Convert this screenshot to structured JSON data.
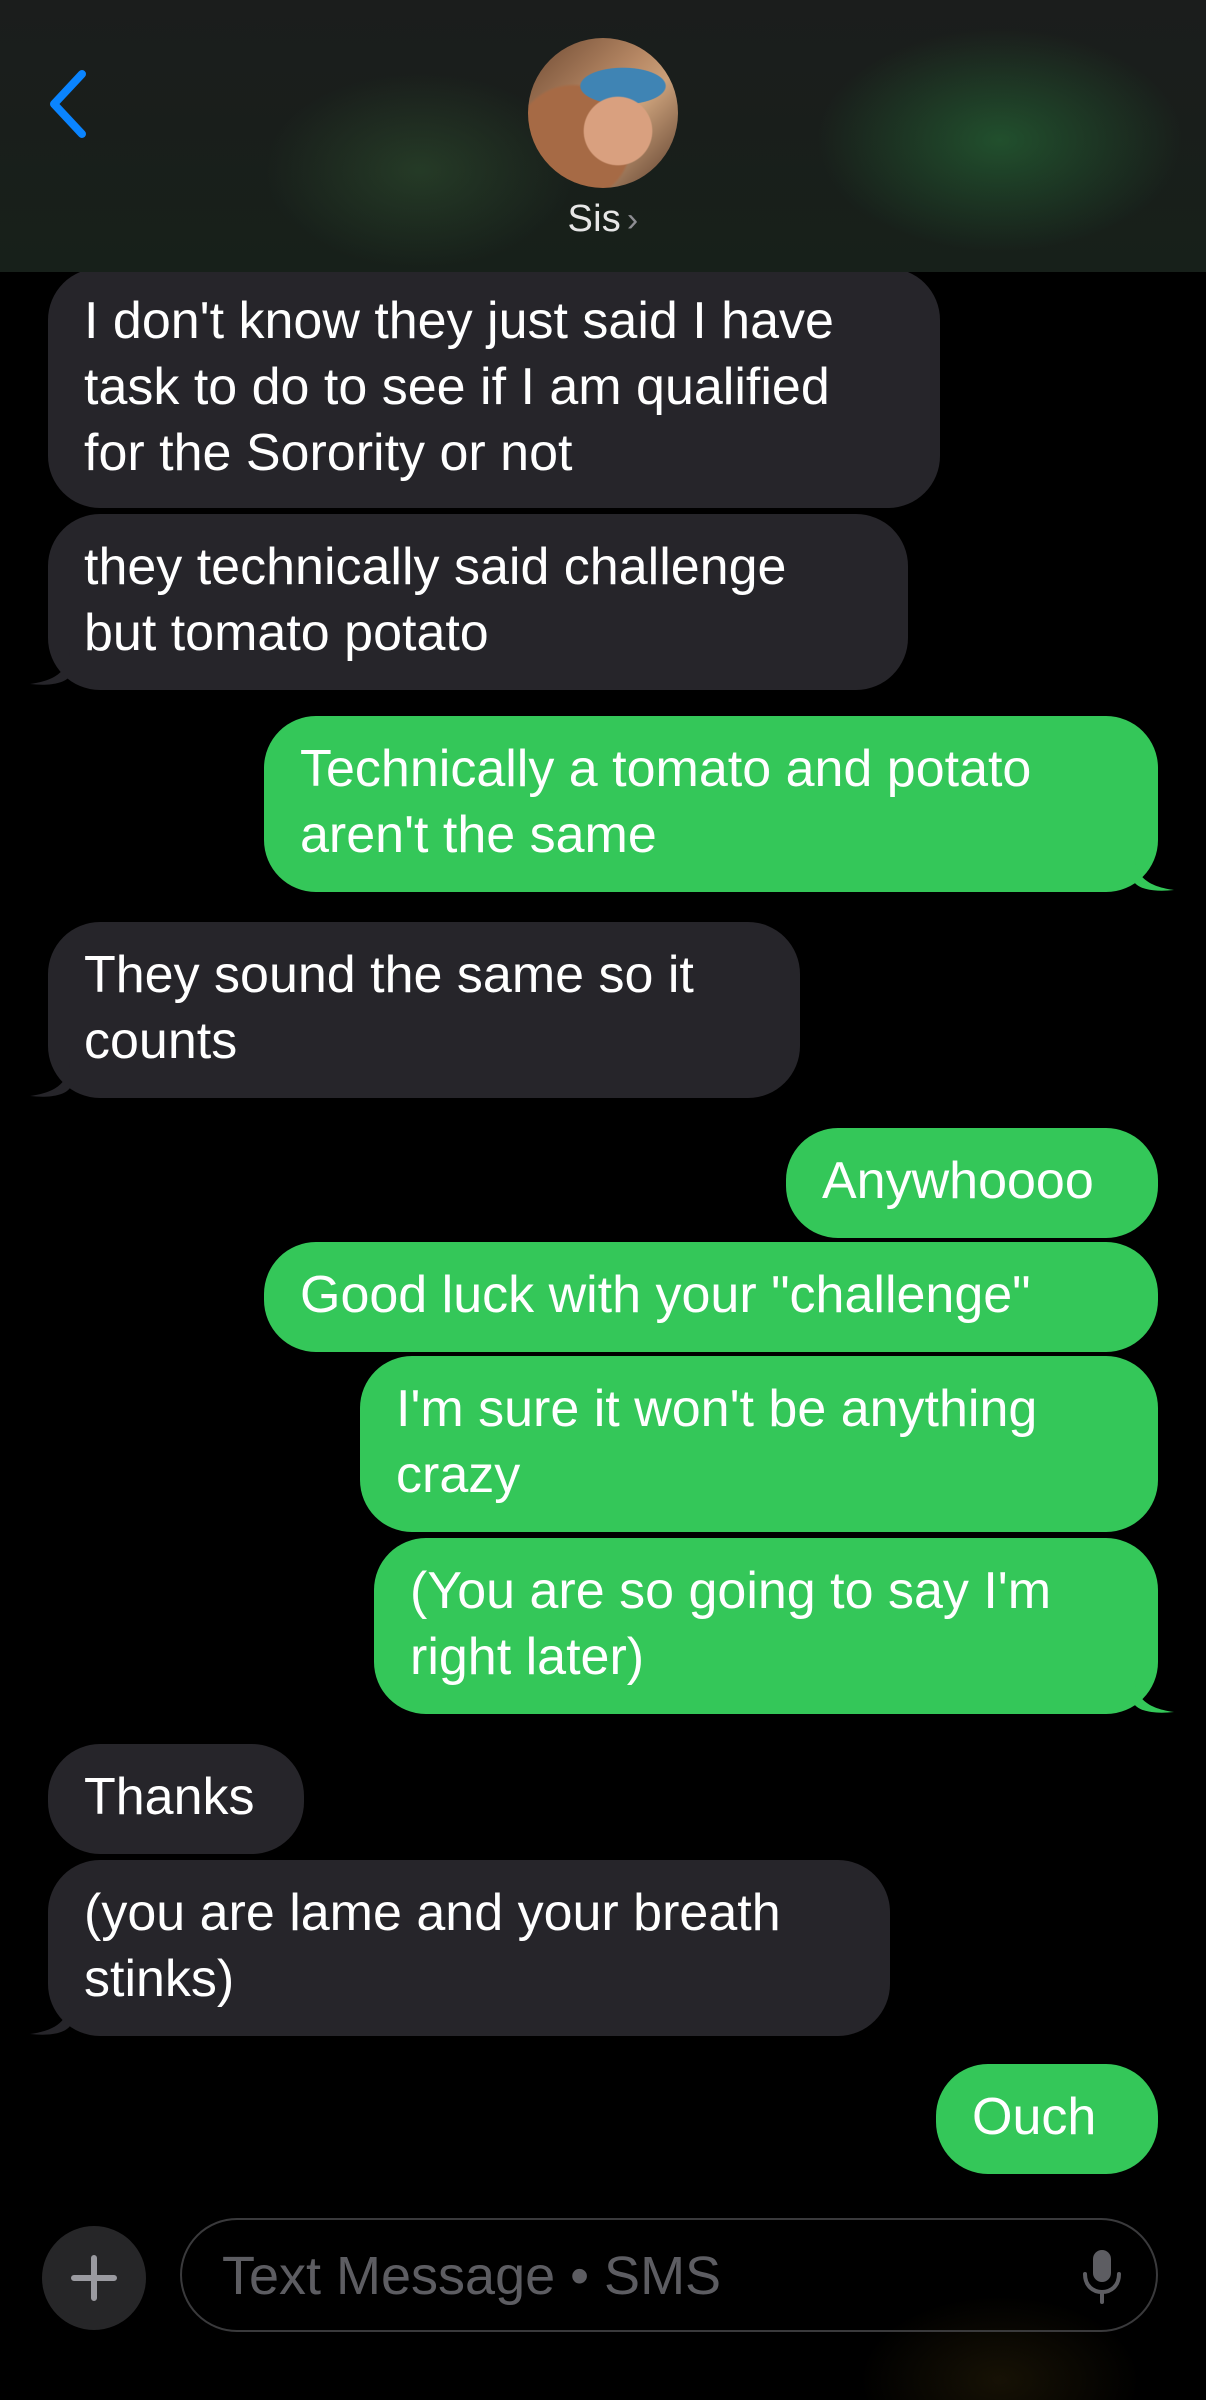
{
  "header": {
    "contact_name": "Sis",
    "name_chevron": "›"
  },
  "messages": [
    {
      "direction": "incoming",
      "text": "I don't know they just said I have task to do to see if I am qualified for the Sorority or not"
    },
    {
      "direction": "incoming",
      "text": "they technically said challenge but tomato potato"
    },
    {
      "direction": "outgoing",
      "text": "Technically a tomato and potato aren't the same"
    },
    {
      "direction": "incoming",
      "text": "They sound the same so it counts"
    },
    {
      "direction": "outgoing",
      "text": "Anywhoooo"
    },
    {
      "direction": "outgoing",
      "text": "Good luck with your \"challenge\""
    },
    {
      "direction": "outgoing",
      "text": "I'm sure it won't be anything crazy"
    },
    {
      "direction": "outgoing",
      "text": "(You are so going to say I'm right later)"
    },
    {
      "direction": "incoming",
      "text": "Thanks"
    },
    {
      "direction": "incoming",
      "text": "(you are lame and your breath stinks)"
    },
    {
      "direction": "outgoing",
      "text": "Ouch"
    }
  ],
  "composer": {
    "placeholder": "Text Message • SMS"
  },
  "colors": {
    "incoming_bubble": "#26252a",
    "outgoing_bubble": "#34c759",
    "accent": "#0a84ff"
  },
  "icons": {
    "back": "chevron-left-icon",
    "plus": "plus-icon",
    "mic": "microphone-icon"
  }
}
